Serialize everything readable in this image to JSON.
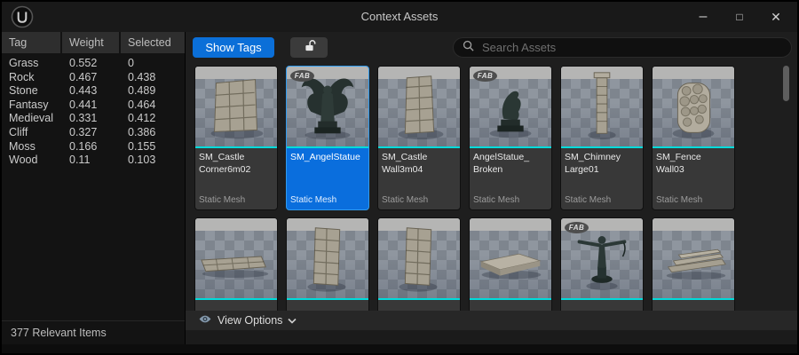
{
  "window": {
    "title": "Context Assets",
    "logo": "unreal-engine-logo",
    "controls": {
      "minimize": "–",
      "maximize": "□",
      "close": "✕"
    }
  },
  "colors": {
    "selection_blue": "#0a6edd",
    "button_blue": "#0b6fd8",
    "accent_cyan": "#00dbdb"
  },
  "tag_table": {
    "columns": [
      "Tag",
      "Weight",
      "Selected"
    ],
    "rows": [
      {
        "tag": "Grass",
        "weight": "0.552",
        "selected": "0"
      },
      {
        "tag": "Rock",
        "weight": "0.467",
        "selected": "0.438"
      },
      {
        "tag": "Stone",
        "weight": "0.443",
        "selected": "0.489"
      },
      {
        "tag": "Fantasy",
        "weight": "0.441",
        "selected": "0.464"
      },
      {
        "tag": "Medieval",
        "weight": "0.331",
        "selected": "0.412"
      },
      {
        "tag": "Cliff",
        "weight": "0.327",
        "selected": "0.386"
      },
      {
        "tag": "Moss",
        "weight": "0.166",
        "selected": "0.155"
      },
      {
        "tag": "Wood",
        "weight": "0.11",
        "selected": "0.103"
      }
    ]
  },
  "toolbar": {
    "show_tags_label": "Show Tags",
    "lock_icon": "unlock-icon",
    "search_placeholder": "Search Assets"
  },
  "asset_grid": {
    "fab_badge_label": "FAB",
    "tiles": [
      {
        "name": "SM_Castle\nCorner6m02",
        "type": "Static Mesh",
        "selected": false,
        "fab_badge": false,
        "shape": "castle-corner-wall"
      },
      {
        "name": "SM_AngelStatue",
        "type": "Static Mesh",
        "selected": true,
        "fab_badge": true,
        "shape": "angel-statue"
      },
      {
        "name": "SM_Castle\nWall3m04",
        "type": "Static Mesh",
        "selected": false,
        "fab_badge": false,
        "shape": "castle-wall"
      },
      {
        "name": "AngelStatue_\nBroken",
        "type": "Static Mesh",
        "selected": false,
        "fab_badge": true,
        "shape": "broken-angel-statue"
      },
      {
        "name": "SM_Chimney\nLarge01",
        "type": "Static Mesh",
        "selected": false,
        "fab_badge": false,
        "shape": "chimney"
      },
      {
        "name": "SM_Fence\nWall03",
        "type": "Static Mesh",
        "selected": false,
        "fab_badge": false,
        "shape": "fence-wall"
      },
      {
        "name": "",
        "type": "",
        "selected": false,
        "fab_badge": false,
        "cropped": true,
        "shape": "low-wall"
      },
      {
        "name": "",
        "type": "",
        "selected": false,
        "fab_badge": false,
        "cropped": true,
        "shape": "stone-pillar"
      },
      {
        "name": "",
        "type": "",
        "selected": false,
        "fab_badge": false,
        "cropped": true,
        "shape": "stone-pillar"
      },
      {
        "name": "",
        "type": "",
        "selected": false,
        "fab_badge": false,
        "cropped": true,
        "shape": "stone-platform"
      },
      {
        "name": "",
        "type": "",
        "selected": false,
        "fab_badge": true,
        "cropped": true,
        "shape": "statue-arms-out"
      },
      {
        "name": "",
        "type": "",
        "selected": false,
        "fab_badge": false,
        "cropped": true,
        "shape": "stone-steps"
      }
    ]
  },
  "view_options": {
    "label": "View Options",
    "icon": "eye-icon",
    "chevron": "chevron-down-icon"
  },
  "status_bar": {
    "items_count": "377 Relevant Items"
  }
}
